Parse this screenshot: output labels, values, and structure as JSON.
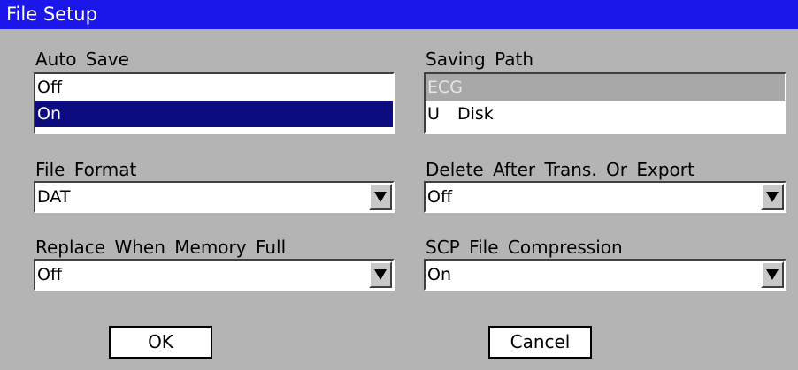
{
  "window": {
    "title": "File Setup"
  },
  "auto_save": {
    "label": "Auto Save",
    "options": [
      "Off",
      "On"
    ],
    "selected": "On"
  },
  "saving_path": {
    "label": "Saving Path",
    "options": [
      "ECG",
      "U  Disk"
    ],
    "selected": "ECG"
  },
  "file_format": {
    "label": "File Format",
    "value": "DAT"
  },
  "delete_after": {
    "label": "Delete After Trans. Or Export",
    "value": "Off"
  },
  "replace_full": {
    "label": "Replace When Memory Full",
    "value": "Off"
  },
  "scp_compression": {
    "label": "SCP File Compression",
    "value": "On"
  },
  "buttons": {
    "ok": "OK",
    "cancel": "Cancel"
  },
  "colors": {
    "titlebar": "#1b17ea",
    "background": "#b4b4b4",
    "selection": "#0c0c80"
  },
  "icons": {
    "dropdown": "chevron-down-icon"
  }
}
